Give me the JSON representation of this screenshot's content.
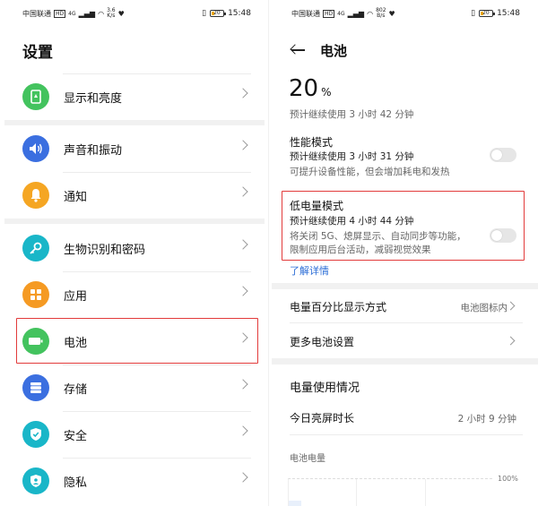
{
  "status_bar": {
    "carrier": "中国联通",
    "hd": "HD",
    "signal": "4G",
    "left_speed": "3.6",
    "left_speed_unit": "K/s",
    "right_speed": "802",
    "right_speed_unit": "B/s",
    "battery": "20",
    "time": "15:48"
  },
  "settings": {
    "title": "设置",
    "items": [
      {
        "label": "显示和亮度",
        "icon": "brightness-icon",
        "color": "#43c35e"
      },
      {
        "label": "声音和振动",
        "icon": "speaker-icon",
        "color": "#3b6fe0"
      },
      {
        "label": "通知",
        "icon": "bell-icon",
        "color": "#f5a623"
      },
      {
        "label": "生物识别和密码",
        "icon": "key-icon",
        "color": "#19b6c8"
      },
      {
        "label": "应用",
        "icon": "apps-icon",
        "color": "#f59a23"
      },
      {
        "label": "电池",
        "icon": "battery-icon",
        "color": "#43c35e"
      },
      {
        "label": "存储",
        "icon": "storage-icon",
        "color": "#3b6fe0"
      },
      {
        "label": "安全",
        "icon": "shield-icon",
        "color": "#19b6c8"
      },
      {
        "label": "隐私",
        "icon": "privacy-icon",
        "color": "#19b6c8"
      }
    ]
  },
  "battery": {
    "title": "电池",
    "percent": "20",
    "percent_unit": "%",
    "remaining": "预计继续使用 3 小时 42 分钟",
    "performance": {
      "title": "性能模式",
      "estimate": "预计继续使用 3 小时 31 分钟",
      "desc": "可提升设备性能，但会增加耗电和发热"
    },
    "low_power": {
      "title": "低电量模式",
      "estimate": "预计继续使用 4 小时 44 分钟",
      "desc_line1": "将关闭 5G、熄屏显示、自动同步等功能，",
      "desc_line2": "限制应用后台活动，减弱视觉效果"
    },
    "learn_more": "了解详情",
    "percent_display_label": "电量百分比显示方式",
    "percent_display_value": "电池图标内",
    "more_settings": "更多电池设置",
    "usage_title": "电量使用情况",
    "screen_on_label": "今日亮屏时长",
    "screen_on_value": "2 小时 9 分钟",
    "battery_level_label": "电池电量",
    "chart_max": "100%"
  }
}
